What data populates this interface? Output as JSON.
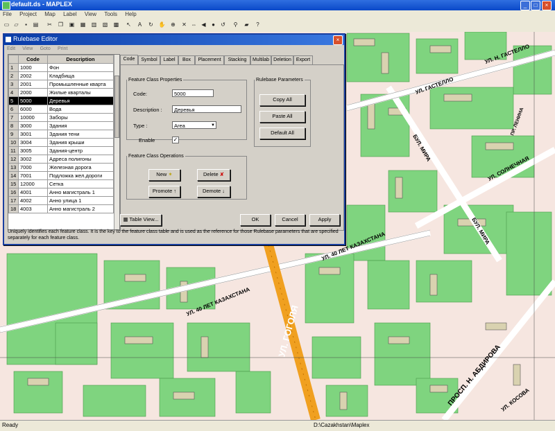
{
  "window": {
    "title": "default.ds - MAPLEX",
    "min": "_",
    "max": "□",
    "close": "×"
  },
  "menu": [
    "File",
    "Project",
    "Map",
    "Label",
    "View",
    "Tools",
    "Help"
  ],
  "toolbar_icons": [
    "new-icon",
    "open-icon",
    "save-icon",
    "print-icon",
    "cut-icon",
    "copy-icon",
    "paste-icon",
    "grid-icon",
    "table-icon",
    "layer-icon",
    "query-icon",
    "pointer-icon",
    "label-icon",
    "rotate-icon",
    "pan-icon",
    "zoom-in-icon",
    "zoom-out-icon",
    "full-extent-icon",
    "back-icon",
    "forward-icon",
    "refresh-icon",
    "find-icon",
    "identify-icon",
    "help-icon"
  ],
  "dialog": {
    "title": "Rulebase Editor",
    "menu": [
      "Edit",
      "View",
      "Goto",
      "Print"
    ],
    "table": {
      "headers": [
        "",
        "Code",
        "Description"
      ],
      "rows": [
        {
          "n": "1",
          "code": "1000",
          "desc": "Фон"
        },
        {
          "n": "2",
          "code": "2002",
          "desc": "Кладбища"
        },
        {
          "n": "3",
          "code": "2001",
          "desc": "Промышленные кварта"
        },
        {
          "n": "4",
          "code": "2000",
          "desc": "Жилые кварталы"
        },
        {
          "n": "5",
          "code": "5000",
          "desc": "Деревья",
          "selected": true
        },
        {
          "n": "6",
          "code": "6000",
          "desc": "Вода"
        },
        {
          "n": "7",
          "code": "10000",
          "desc": "Заборы"
        },
        {
          "n": "8",
          "code": "3000",
          "desc": "Здания"
        },
        {
          "n": "9",
          "code": "3001",
          "desc": "Здания тени"
        },
        {
          "n": "10",
          "code": "3004",
          "desc": "Здания крыши"
        },
        {
          "n": "11",
          "code": "3005",
          "desc": "Здания-центр"
        },
        {
          "n": "12",
          "code": "3002",
          "desc": "Адреса полигоны"
        },
        {
          "n": "13",
          "code": "7000",
          "desc": "Железная дорога"
        },
        {
          "n": "14",
          "code": "7001",
          "desc": "Подложка жел.дороги"
        },
        {
          "n": "15",
          "code": "12000",
          "desc": "Сетка"
        },
        {
          "n": "16",
          "code": "4001",
          "desc": "Анно магистраль 1"
        },
        {
          "n": "17",
          "code": "4002",
          "desc": "Анно улица 1"
        },
        {
          "n": "18",
          "code": "4003",
          "desc": "Анно магистраль 2"
        }
      ]
    },
    "tabs": [
      "Code",
      "Symbol",
      "Label",
      "Box",
      "Placement",
      "Stacking",
      "Multilab",
      "Deletion",
      "Export"
    ],
    "fc_props": {
      "legend": "Feature Class Properties",
      "code_label": "Code:",
      "code_value": "5000",
      "desc_label": "Description :",
      "desc_value": "Деревья",
      "type_label": "Type :",
      "type_value": "Area",
      "enable_label": "Enable",
      "enable_mark": "✓"
    },
    "rb_params": {
      "legend": "Rulebase Parameters",
      "copy": "Copy All",
      "paste": "Paste All",
      "default": "Default All"
    },
    "fc_ops": {
      "legend": "Feature Class Operations",
      "new": "New",
      "delete": "Delete",
      "promote": "Promote",
      "demote": "Demote"
    },
    "table_view": "Table View...",
    "ok": "OK",
    "cancel": "Cancel",
    "apply": "Apply",
    "info": "Uniquely identifies each feature class. It is the key to the feature class table and is used as the reference for those Rulebase parameters that are specified separately for each feature class."
  },
  "map_labels": [
    "УЛ. Н. ГАСТЕЛЛО",
    "УЛ. ГАСТЕЛЛО",
    "ПР. ЛЕНИНА",
    "БУЛ. МИРА",
    "УЛ. СОЛНЕЧНАЯ",
    "БУЛ. МИРА",
    "УЛ. 40 ЛЕТ КАЗАХСТАНА",
    "УЛ. 40 ЛЕТ КАЗАХСТАНА",
    "УЛ. ГОГОЛЯ",
    "ПРОСП. Н. АБДИРОВА",
    "УЛ. КОСОВА"
  ],
  "status": {
    "left": "Ready",
    "right": "D:\\Cazakhstan\\Maplex"
  }
}
